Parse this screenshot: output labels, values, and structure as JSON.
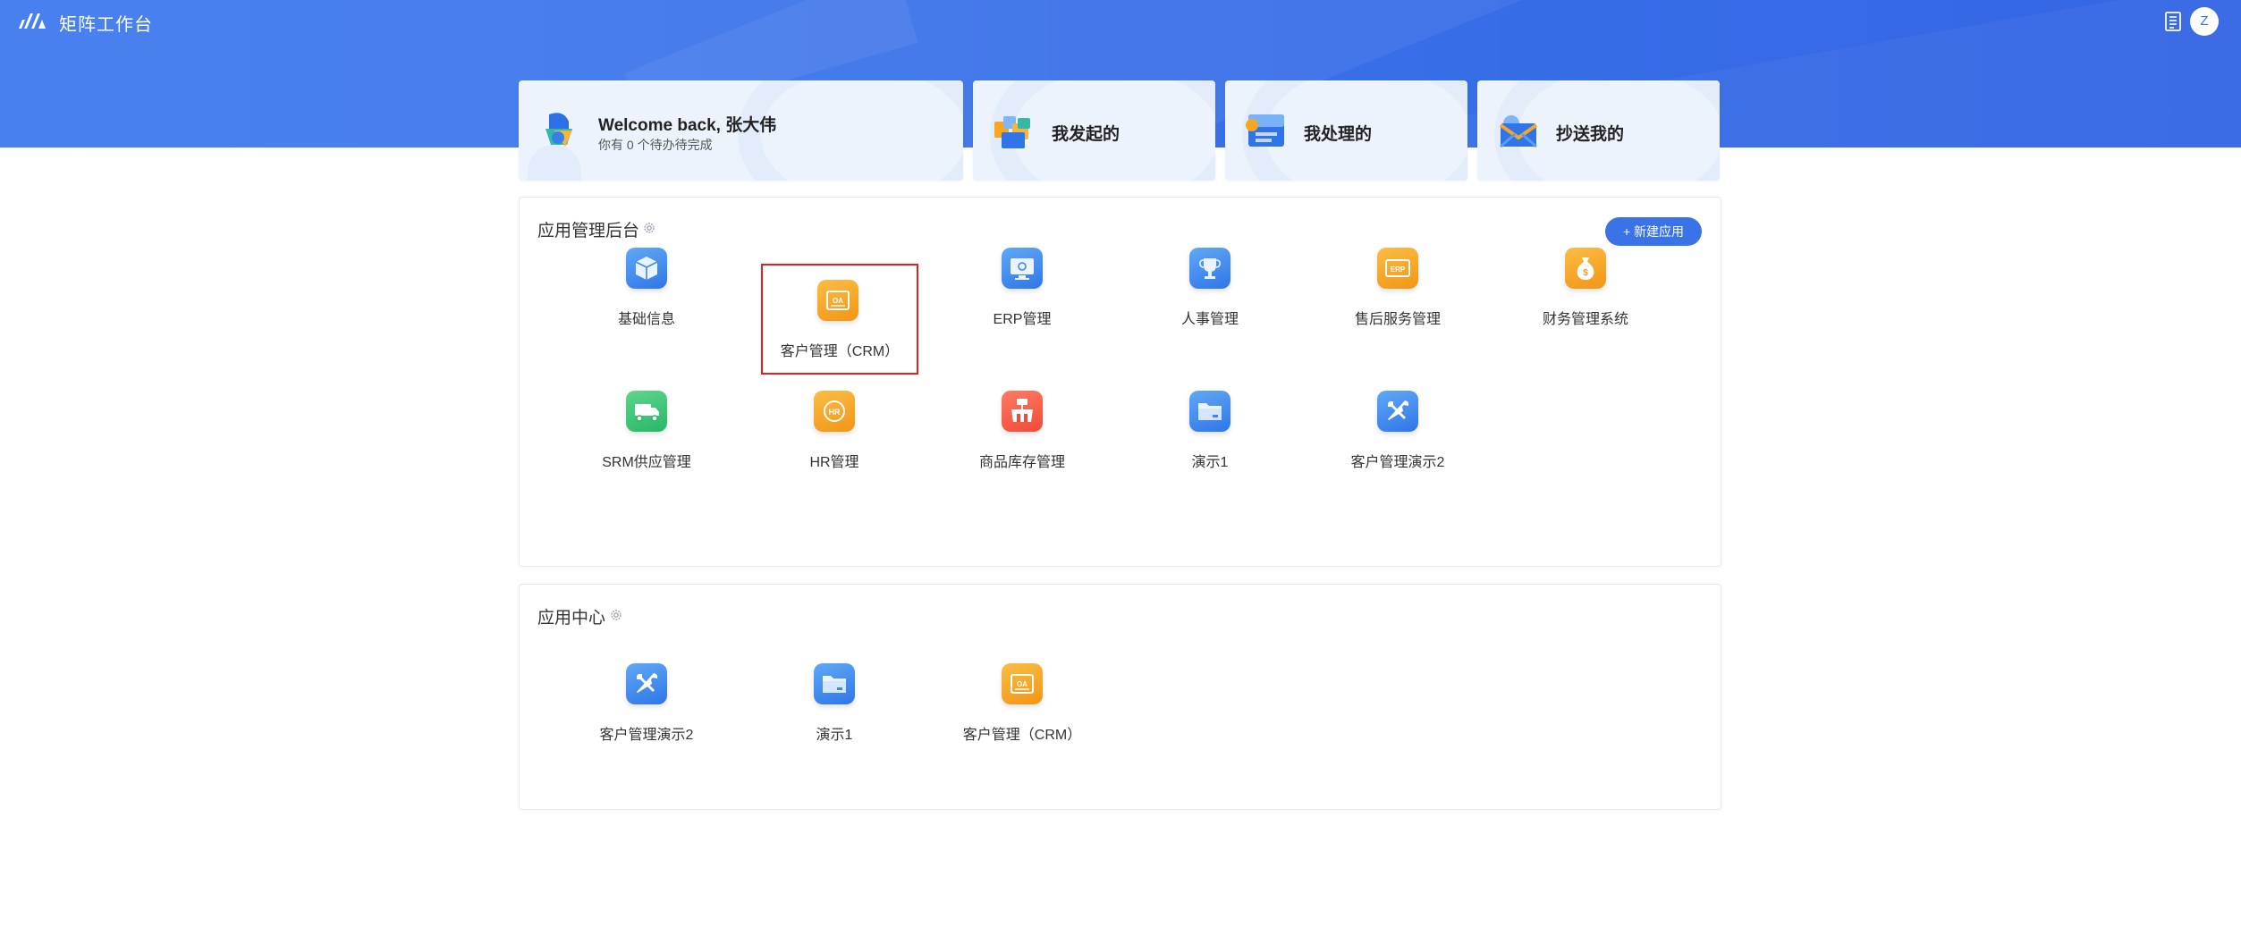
{
  "header": {
    "brand": "矩阵工作台",
    "avatar_letter": "Z"
  },
  "cards": {
    "welcome_title": "Welcome back, 张大伟",
    "welcome_sub": "你有 0 个待办待完成",
    "initiated": "我发起的",
    "handled": "我处理的",
    "cc": "抄送我的"
  },
  "admin": {
    "title": "应用管理后台",
    "new_button": "+ 新建应用",
    "apps": [
      {
        "label": "基础信息",
        "icon": "cube-icon",
        "color": "#3a87ee"
      },
      {
        "label": "客户管理（CRM）",
        "icon": "oa-icon",
        "color": "#f5a623",
        "selected": true
      },
      {
        "label": "ERP管理",
        "icon": "monitor-icon",
        "color": "#3a87ee"
      },
      {
        "label": "人事管理",
        "icon": "trophy-icon",
        "color": "#3a87ee"
      },
      {
        "label": "售后服务管理",
        "icon": "erp-icon",
        "color": "#f5a623"
      },
      {
        "label": "财务管理系统",
        "icon": "money-bag-icon",
        "color": "#f5a623"
      },
      {
        "label": "SRM供应管理",
        "icon": "truck-icon",
        "color": "#2fbf6d"
      },
      {
        "label": "HR管理",
        "icon": "hr-icon",
        "color": "#f5a623"
      },
      {
        "label": "商品库存管理",
        "icon": "shop-icon",
        "color": "#f15a45"
      },
      {
        "label": "演示1",
        "icon": "folder-icon",
        "color": "#3a87ee"
      },
      {
        "label": "客户管理演示2",
        "icon": "tools-icon",
        "color": "#3a87ee"
      }
    ]
  },
  "center": {
    "title": "应用中心",
    "apps": [
      {
        "label": "客户管理演示2",
        "icon": "tools-icon",
        "color": "#3a87ee"
      },
      {
        "label": "演示1",
        "icon": "folder-icon",
        "color": "#3a87ee"
      },
      {
        "label": "客户管理（CRM）",
        "icon": "oa-icon",
        "color": "#f5a623"
      }
    ]
  }
}
